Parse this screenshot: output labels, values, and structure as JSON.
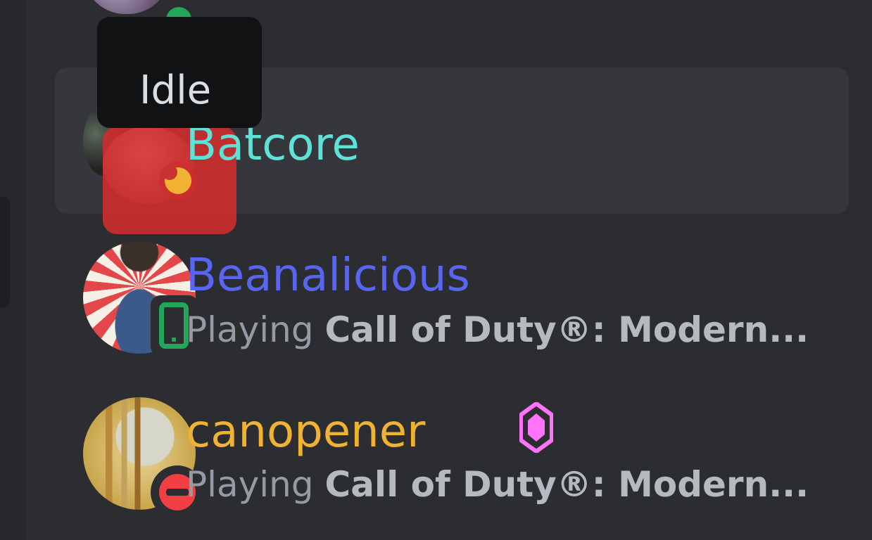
{
  "colors": {
    "background": "#2b2d31",
    "hover_row": "#35373c",
    "tooltip_bg": "#111214",
    "online": "#23a55a",
    "dnd": "#f23f43",
    "idle": "#f0b232",
    "nitro_badge": "#ff73fa"
  },
  "tooltip": {
    "text": "Idle"
  },
  "members": [
    {
      "name": "Batcore",
      "name_color": "#5ee2d7",
      "status": "idle",
      "status_icon": "moon-icon",
      "hovered": true
    },
    {
      "name": "Beanalicious",
      "name_color": "#5865f2",
      "status": "online-mobile",
      "status_icon": "mobile-phone-icon",
      "activity_prefix": "Playing",
      "activity_game": "Call of Duty®: Modern..."
    },
    {
      "name": "canopener",
      "name_color": "#f0b232",
      "status": "dnd",
      "status_icon": "do-not-disturb-icon",
      "badge_icon": "nitro-gem-icon",
      "activity_prefix": "Playing",
      "activity_game": "Call of Duty®: Modern..."
    }
  ]
}
